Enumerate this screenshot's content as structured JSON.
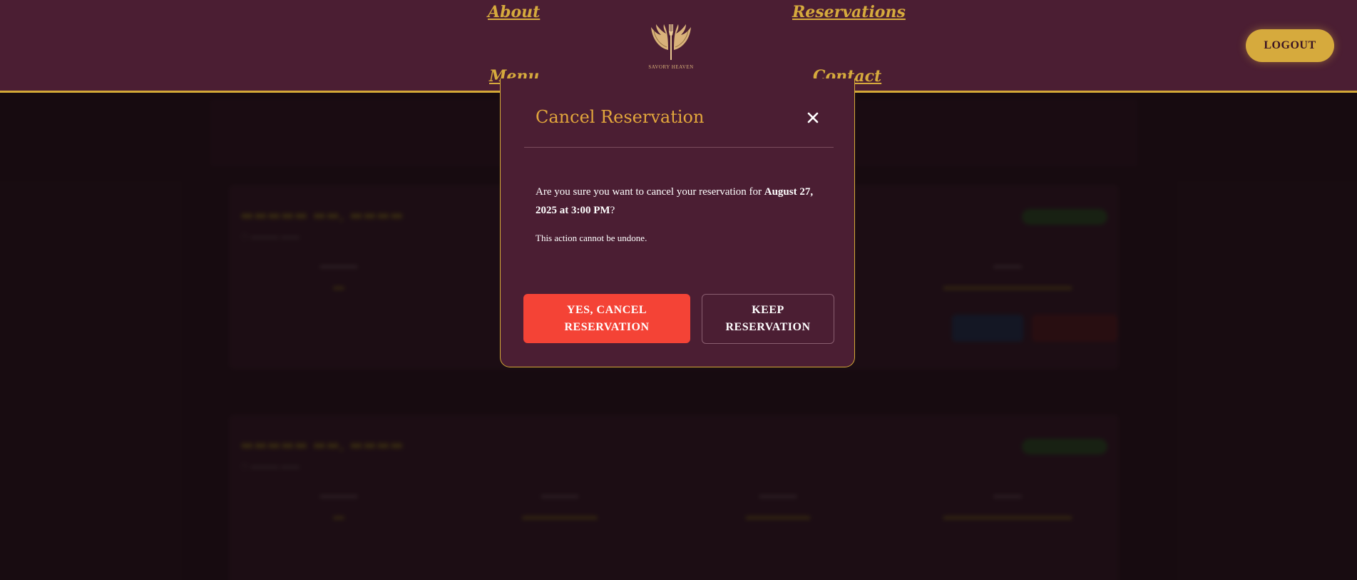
{
  "nav": {
    "about": "About",
    "reservations": "Reservations",
    "menu": "Menu",
    "contact": "Contact",
    "logo_text": "SAVORY HEAVEN",
    "logout": "LOGOUT"
  },
  "modal": {
    "title": "Cancel Reservation",
    "confirm_prefix": "Are you sure you want to cancel your reservation for ",
    "confirm_datetime": "August 27, 2025 at 3:00 PM",
    "confirm_suffix": "?",
    "note": "This action cannot be undone.",
    "yes_button": "YES, CANCEL RESERVATION",
    "keep_button": "KEEP RESERVATION"
  },
  "colors": {
    "header_bg": "#4b1e33",
    "accent_gold": "#d6aa3d",
    "danger_red": "#f44336",
    "modal_title": "#e2a63c"
  },
  "icons": {
    "close": "close-icon",
    "logo": "fork-wings-logo-icon"
  }
}
